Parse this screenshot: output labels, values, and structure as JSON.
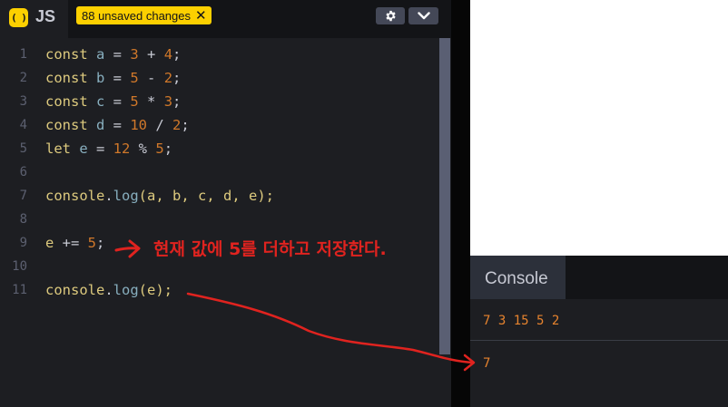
{
  "editor": {
    "logo_text": "( )",
    "tab_title": "JS",
    "unsaved_badge": "88 unsaved changes",
    "unsaved_close": "✕",
    "settings_icon": "gear-icon",
    "collapse_icon": "chevron-down-icon",
    "lines": [
      {
        "num": "1",
        "tokens": [
          {
            "t": "const ",
            "c": "kw"
          },
          {
            "t": "a",
            "c": "var"
          },
          {
            "t": " = ",
            "c": "op"
          },
          {
            "t": "3",
            "c": "num"
          },
          {
            "t": " + ",
            "c": "op"
          },
          {
            "t": "4",
            "c": "num"
          },
          {
            "t": ";",
            "c": "op"
          }
        ]
      },
      {
        "num": "2",
        "tokens": [
          {
            "t": "const ",
            "c": "kw"
          },
          {
            "t": "b",
            "c": "var"
          },
          {
            "t": " = ",
            "c": "op"
          },
          {
            "t": "5",
            "c": "num"
          },
          {
            "t": " - ",
            "c": "op"
          },
          {
            "t": "2",
            "c": "num"
          },
          {
            "t": ";",
            "c": "op"
          }
        ]
      },
      {
        "num": "3",
        "tokens": [
          {
            "t": "const ",
            "c": "kw"
          },
          {
            "t": "c",
            "c": "var"
          },
          {
            "t": " = ",
            "c": "op"
          },
          {
            "t": "5",
            "c": "num"
          },
          {
            "t": " * ",
            "c": "op"
          },
          {
            "t": "3",
            "c": "num"
          },
          {
            "t": ";",
            "c": "op"
          }
        ]
      },
      {
        "num": "4",
        "tokens": [
          {
            "t": "const ",
            "c": "kw"
          },
          {
            "t": "d",
            "c": "var"
          },
          {
            "t": " = ",
            "c": "op"
          },
          {
            "t": "10",
            "c": "num"
          },
          {
            "t": " / ",
            "c": "op"
          },
          {
            "t": "2",
            "c": "num"
          },
          {
            "t": ";",
            "c": "op"
          }
        ]
      },
      {
        "num": "5",
        "tokens": [
          {
            "t": "let ",
            "c": "kw"
          },
          {
            "t": "e",
            "c": "var"
          },
          {
            "t": " = ",
            "c": "op"
          },
          {
            "t": "12",
            "c": "num"
          },
          {
            "t": " % ",
            "c": "op"
          },
          {
            "t": "5",
            "c": "num"
          },
          {
            "t": ";",
            "c": "op"
          }
        ]
      },
      {
        "num": "6",
        "tokens": []
      },
      {
        "num": "7",
        "tokens": [
          {
            "t": "console",
            "c": "kw"
          },
          {
            "t": ".",
            "c": "op"
          },
          {
            "t": "log",
            "c": "fn"
          },
          {
            "t": "(a, b, c, d, e);",
            "c": "kw"
          }
        ]
      },
      {
        "num": "8",
        "tokens": []
      },
      {
        "num": "9",
        "tokens": [
          {
            "t": "e",
            "c": "kw"
          },
          {
            "t": " += ",
            "c": "op"
          },
          {
            "t": "5",
            "c": "num"
          },
          {
            "t": ";",
            "c": "op"
          }
        ]
      },
      {
        "num": "10",
        "tokens": []
      },
      {
        "num": "11",
        "tokens": [
          {
            "t": "console",
            "c": "kw"
          },
          {
            "t": ".",
            "c": "op"
          },
          {
            "t": "log",
            "c": "fn"
          },
          {
            "t": "(e);",
            "c": "kw"
          }
        ]
      }
    ]
  },
  "console": {
    "title": "Console",
    "output": [
      "7 3 15 5 2",
      "7"
    ]
  },
  "annotation": {
    "text": "현재 값에 5를 더하고 저장한다.",
    "color": "#e0231f"
  },
  "colors": {
    "accent": "#fcd000",
    "keyword": "#ddca7e",
    "variable": "#88afbf",
    "number": "#d0782a",
    "console_output": "#e6832e"
  }
}
